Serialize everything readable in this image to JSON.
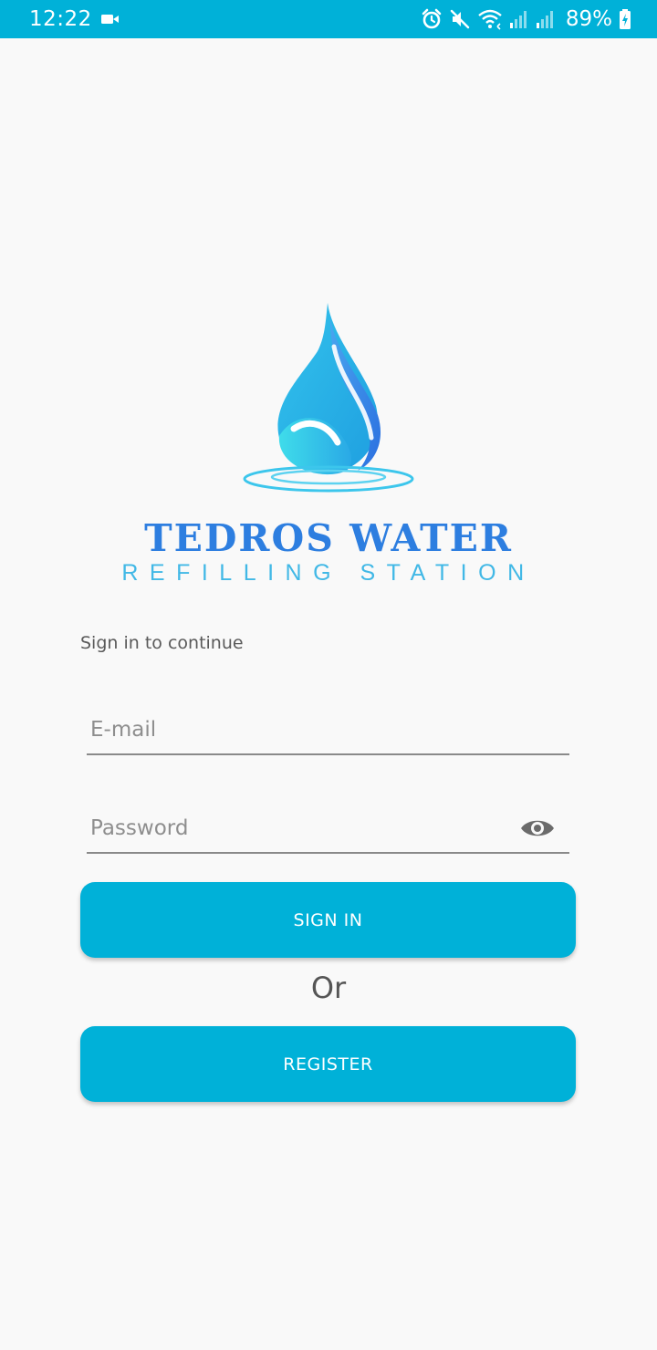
{
  "status_bar": {
    "time": "12:22",
    "battery": "89%",
    "icons": [
      "video-camera-icon",
      "alarm-icon",
      "mute-icon",
      "wifi-icon",
      "signal-icon",
      "signal-icon",
      "battery-charging-icon"
    ]
  },
  "brand": {
    "title": "TEDROS WATER",
    "subtitle": "REFILLING STATION",
    "logo_icon": "water-drop-logo"
  },
  "login": {
    "caption": "Sign in to continue",
    "email_placeholder": "E-mail",
    "password_placeholder": "Password",
    "sign_in_label": "SIGN IN",
    "or_label": "Or",
    "register_label": "REGISTER"
  },
  "colors": {
    "accent": "#00b1d8",
    "brand_title": "#2d7ee0",
    "brand_subtitle": "#41b8e6",
    "background": "#f9f9f9"
  }
}
